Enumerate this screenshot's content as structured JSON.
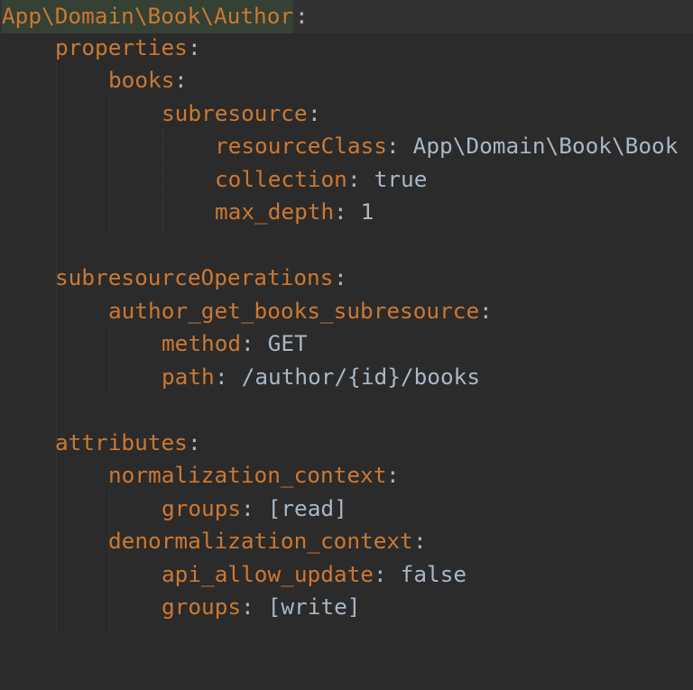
{
  "editor": {
    "lines": [
      {
        "key": "App\\Domain\\Book\\Author",
        "colon": ":",
        "value": ""
      },
      {
        "key": "properties",
        "colon": ":",
        "value": ""
      },
      {
        "key": "books",
        "colon": ":",
        "value": ""
      },
      {
        "key": "subresource",
        "colon": ":",
        "value": ""
      },
      {
        "key": "resourceClass",
        "colon": ":",
        "value": " App\\Domain\\Book\\Book"
      },
      {
        "key": "collection",
        "colon": ":",
        "value": " true"
      },
      {
        "key": "max_depth",
        "colon": ":",
        "value": " 1"
      },
      {
        "key": "",
        "colon": "",
        "value": ""
      },
      {
        "key": "subresourceOperations",
        "colon": ":",
        "value": ""
      },
      {
        "key": "author_get_books_subresource",
        "colon": ":",
        "value": ""
      },
      {
        "key": "method",
        "colon": ":",
        "value": " GET"
      },
      {
        "key": "path",
        "colon": ":",
        "value": " /author/{id}/books"
      },
      {
        "key": "",
        "colon": "",
        "value": ""
      },
      {
        "key": "attributes",
        "colon": ":",
        "value": ""
      },
      {
        "key": "normalization_context",
        "colon": ":",
        "value": ""
      },
      {
        "key": "groups",
        "colon": ":",
        "value": " [read]"
      },
      {
        "key": "denormalization_context",
        "colon": ":",
        "value": ""
      },
      {
        "key": "api_allow_update",
        "colon": ":",
        "value": " false"
      },
      {
        "key": "groups",
        "colon": ":",
        "value": " [write]"
      }
    ]
  }
}
